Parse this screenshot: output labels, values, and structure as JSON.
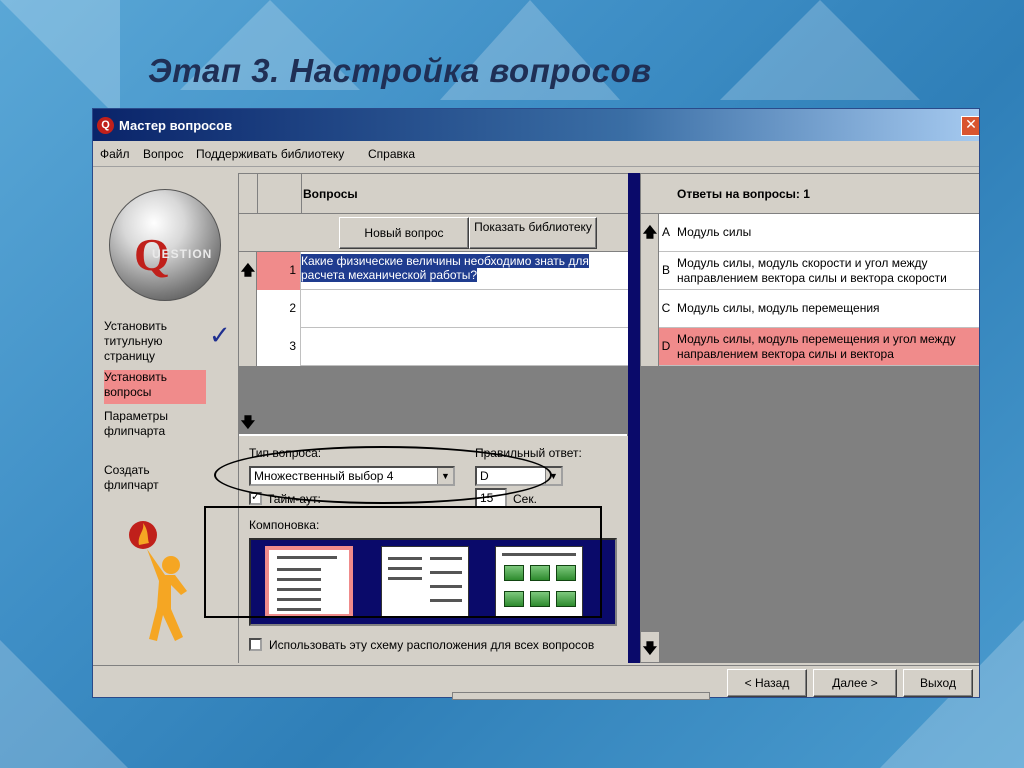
{
  "slide": {
    "title": "Этап 3. Настройка вопросов"
  },
  "window": {
    "title": "Мастер вопросов",
    "app_icon_letter": "Q",
    "close_glyph": "✕"
  },
  "menu": [
    {
      "label": "Файл"
    },
    {
      "label": "Вопрос"
    },
    {
      "label": "Поддерживать библиотеку"
    },
    {
      "label": "Справка"
    }
  ],
  "logo": {
    "letter": "Q",
    "text": "UESTION"
  },
  "steps": [
    {
      "label": "Установить титульную страницу",
      "done": true
    },
    {
      "label": "Установить вопросы",
      "active": true
    },
    {
      "label": "Параметры флипчарта"
    },
    {
      "label": "Создать флипчарт"
    }
  ],
  "questions": {
    "header": "Вопросы",
    "new_button": "Новый вопрос",
    "library_button": "Показать библиотеку",
    "rows": [
      {
        "num": "1",
        "text": "Какие физические величины необходимо знать для расчета механической работы?",
        "selected": true
      },
      {
        "num": "2",
        "text": ""
      },
      {
        "num": "3",
        "text": ""
      }
    ],
    "up_arrow": "🡅",
    "down_arrow": "🡇"
  },
  "settings": {
    "type_label": "Тип вопроса:",
    "type_value": "Множественный выбор 4",
    "correct_label": "Правильный ответ:",
    "correct_value": "D",
    "timeout_label": "Тайм-аут:",
    "timeout_checked": true,
    "timeout_value": "15",
    "timeout_unit": "Сек.",
    "layout_label": "Компоновка:",
    "use_scheme_label": "Использовать эту схему расположения для всех вопросов",
    "combo_arrow": "▼"
  },
  "answers": {
    "header": "Ответы на вопросы: 1",
    "rows": [
      {
        "letter": "A",
        "text": "Модуль силы"
      },
      {
        "letter": "B",
        "text": "Модуль силы, модуль скорости и угол между направлением вектора силы и вектора скорости"
      },
      {
        "letter": "C",
        "text": "Модуль силы, модуль перемещения"
      },
      {
        "letter": "D",
        "text": "Модуль силы, модуль перемещения и угол между направлением вектора силы и вектора",
        "selected": true
      }
    ]
  },
  "footer": {
    "back": "< Назад",
    "next": "Далее >",
    "exit": "Выход"
  },
  "colors": {
    "accent_pink": "#f08b8b",
    "title_navy": "#1f2f55",
    "selection_blue": "#1f3c8f"
  }
}
